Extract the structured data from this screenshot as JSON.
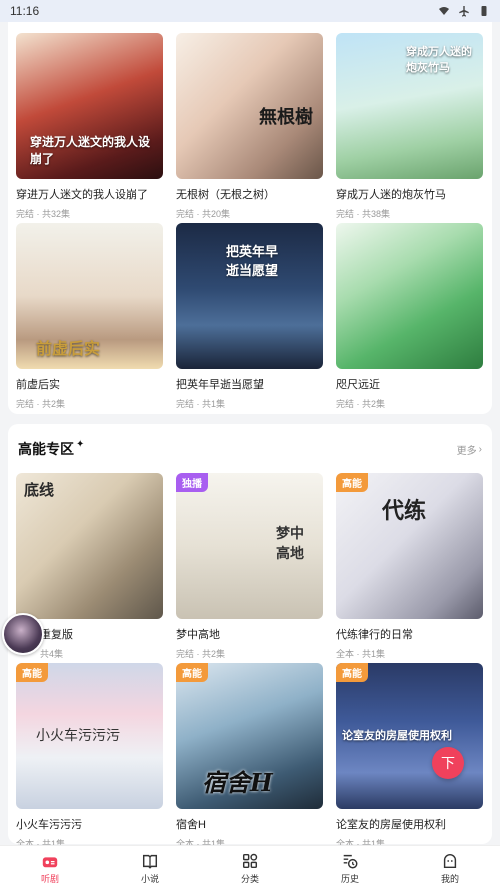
{
  "status_bar": {
    "time": "11:16",
    "icons": [
      "wifi-icon",
      "airplane-icon",
      "battery-icon"
    ]
  },
  "top_grid": [
    {
      "title": "穿进万人迷文的我人设崩了",
      "meta": "完结 · 共32集",
      "cover_text": "穿进万人迷文的我人设崩了"
    },
    {
      "title": "无根树（无根之树）",
      "meta": "完结 · 共20集",
      "cover_text": "無根樹"
    },
    {
      "title": "穿成万人迷的炮灰竹马",
      "meta": "完结 · 共38集",
      "cover_text": "穿成万人迷的炮灰竹马"
    },
    {
      "title": "前虚后实",
      "meta": "完结 · 共2集",
      "cover_text": "前虚后实"
    },
    {
      "title": "把英年早逝当愿望",
      "meta": "完结 · 共1集",
      "cover_text": "把英年早逝当愿望"
    },
    {
      "title": "咫尺远近",
      "meta": "完结 · 共2集",
      "cover_text": ""
    }
  ],
  "gaoneng": {
    "title": "高能专区",
    "more": "更多",
    "items": [
      {
        "title": "重复版",
        "meta": "共4集",
        "badge": "",
        "cover_text": "底线"
      },
      {
        "title": "梦中高地",
        "meta": "完结 · 共2集",
        "badge": "独播",
        "cover_text": "梦中高地"
      },
      {
        "title": "代练律行的日常",
        "meta": "全本 · 共1集",
        "badge": "高能",
        "cover_text": "代练"
      },
      {
        "title": "小火车污污污",
        "meta": "全本 · 共1集",
        "badge": "高能",
        "cover_text": "小火车污污污"
      },
      {
        "title": "宿舍H",
        "meta": "全本 · 共1集",
        "badge": "高能",
        "cover_text": "宿舍H"
      },
      {
        "title": "论室友的房屋使用权利",
        "meta": "全本 · 共1集",
        "badge": "高能",
        "cover_text": "论室友的房屋使用权利"
      }
    ]
  },
  "back_to_top": "下",
  "nav": [
    {
      "label": "听剧",
      "icon": "radio-icon",
      "active": true
    },
    {
      "label": "小说",
      "icon": "book-icon",
      "active": false
    },
    {
      "label": "分类",
      "icon": "grid-icon",
      "active": false
    },
    {
      "label": "历史",
      "icon": "history-icon",
      "active": false
    },
    {
      "label": "我的",
      "icon": "profile-icon",
      "active": false
    }
  ],
  "colors": {
    "accent": "#f0415c",
    "badge_gaoneng": "#f39a3b",
    "badge_dubo": "#a85ef0"
  }
}
